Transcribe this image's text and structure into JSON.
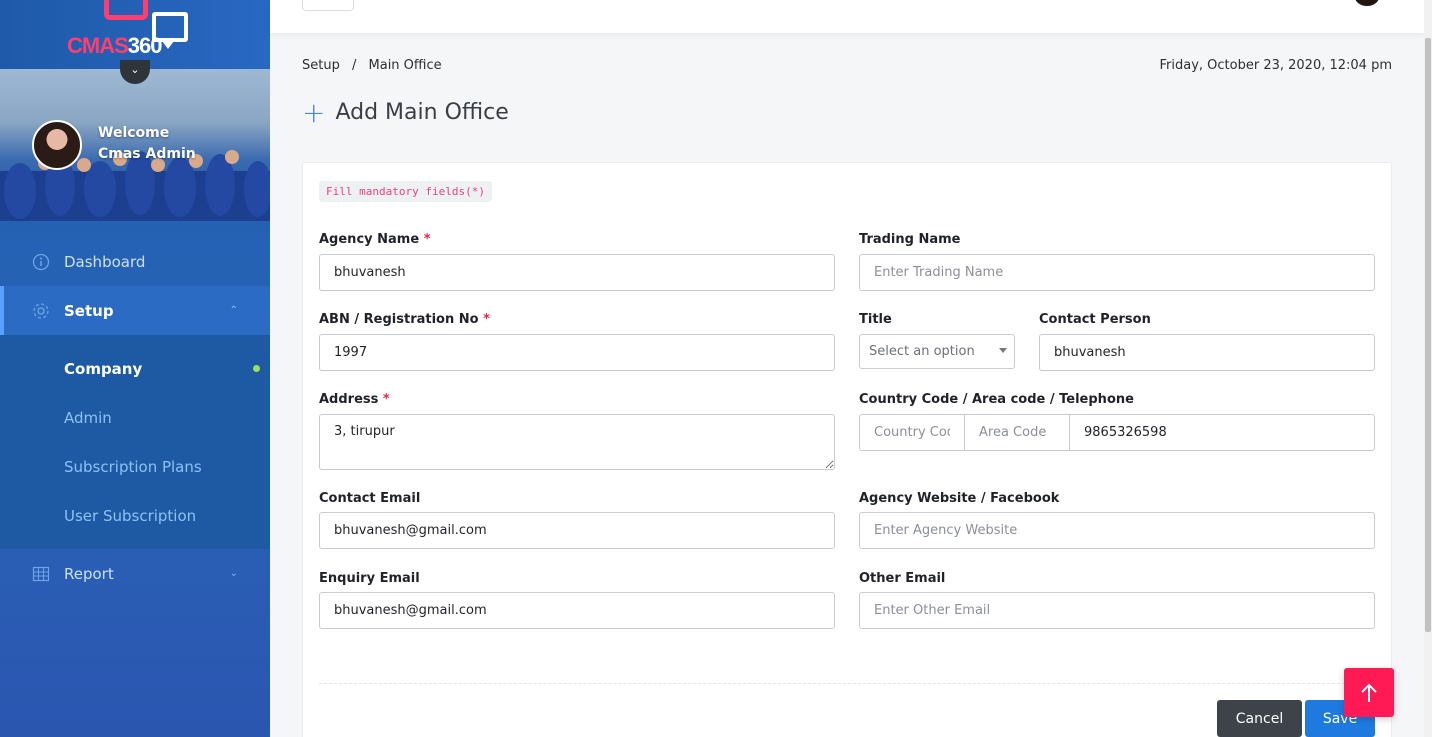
{
  "brand": {
    "logo_text_a": "CMAS",
    "logo_text_b": "360"
  },
  "user": {
    "welcome": "Welcome",
    "name": "Cmas Admin"
  },
  "sidebar": {
    "items": [
      {
        "label": "Dashboard",
        "icon": "info-circle-icon"
      },
      {
        "label": "Setup",
        "icon": "gear-icon",
        "active": true
      },
      {
        "label": "Report",
        "icon": "grid-table-icon"
      }
    ],
    "setup_submenu": [
      {
        "label": "Company",
        "active": true
      },
      {
        "label": "Admin"
      },
      {
        "label": "Subscription Plans"
      },
      {
        "label": "User Subscription"
      }
    ]
  },
  "breadcrumb": {
    "root": "Setup",
    "separator": "/",
    "current": "Main Office"
  },
  "datetime": "Friday, October 23, 2020, 12:04 pm",
  "page": {
    "title": "Add Main Office"
  },
  "form": {
    "mandatory_note": "Fill mandatory fields(*)",
    "required_mark": "*",
    "agency_name": {
      "label": "Agency Name",
      "value": "bhuvanesh"
    },
    "trading_name": {
      "label": "Trading Name",
      "value": "",
      "placeholder": "Enter Trading Name"
    },
    "abn": {
      "label": "ABN / Registration No",
      "value": "1997"
    },
    "title": {
      "label": "Title",
      "placeholder": "Select an option"
    },
    "contact_person": {
      "label": "Contact Person",
      "value": "bhuvanesh"
    },
    "address": {
      "label": "Address",
      "value": "3, tirupur"
    },
    "phone": {
      "label": "Country Code / Area code / Telephone",
      "country_placeholder": "Country Code",
      "area_placeholder": "Area Code",
      "telephone": "9865326598"
    },
    "contact_email": {
      "label": "Contact Email",
      "value": "bhuvanesh@gmail.com"
    },
    "website": {
      "label": "Agency Website / Facebook",
      "value": "",
      "placeholder": "Enter Agency Website"
    },
    "enquiry_email": {
      "label": "Enquiry Email",
      "value": "bhuvanesh@gmail.com"
    },
    "other_email": {
      "label": "Other Email",
      "value": "",
      "placeholder": "Enter Other Email"
    }
  },
  "actions": {
    "cancel": "Cancel",
    "save": "Save"
  },
  "colors": {
    "sidebar": "#2a63b8",
    "accent": "#1f7ae0",
    "scroll_top": "#ff1a55",
    "required": "#e8263d"
  }
}
